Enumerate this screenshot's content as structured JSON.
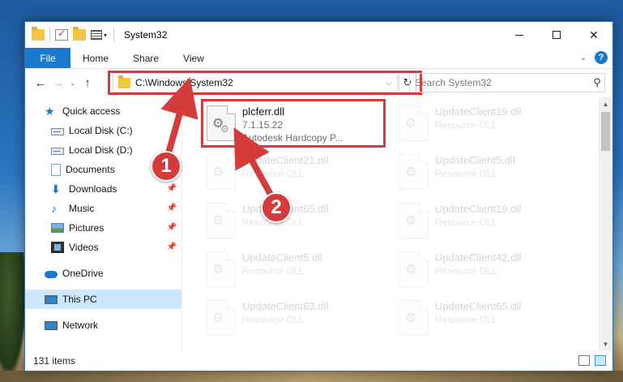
{
  "window": {
    "title": "System32",
    "controls": {
      "minimize": "minimize",
      "maximize": "maximize",
      "close": "✕"
    }
  },
  "ribbon": {
    "tabs": [
      {
        "label": "File",
        "active": true
      },
      {
        "label": "Home"
      },
      {
        "label": "Share"
      },
      {
        "label": "View"
      }
    ],
    "expand": "⌄",
    "help": "?"
  },
  "address": {
    "path": "C:\\Windows\\System32",
    "dropdown": "⌵",
    "refresh": "↻",
    "search_placeholder": "Search System32",
    "search_icon": "⚲"
  },
  "nav_buttons": {
    "back": "←",
    "forward": "→",
    "recent": "⌄",
    "up": "↑"
  },
  "sidebar": {
    "items": [
      {
        "label": "Quick access",
        "icon": "star-icon",
        "pinned": false
      },
      {
        "label": "Local Disk (C:)",
        "icon": "disk-icon",
        "pinned": false
      },
      {
        "label": "Local Disk (D:)",
        "icon": "disk-icon",
        "pinned": false
      },
      {
        "label": "Documents",
        "icon": "documents-icon",
        "pinned": false
      },
      {
        "label": "Downloads",
        "icon": "downloads-icon",
        "pinned": true
      },
      {
        "label": "Music",
        "icon": "music-icon",
        "pinned": true
      },
      {
        "label": "Pictures",
        "icon": "pictures-icon",
        "pinned": true
      },
      {
        "label": "Videos",
        "icon": "videos-icon",
        "pinned": true
      },
      {
        "label": "OneDrive",
        "icon": "onedrive-icon",
        "pinned": false
      },
      {
        "label": "This PC",
        "icon": "this-pc-icon",
        "pinned": false,
        "selected": true
      },
      {
        "label": "Network",
        "icon": "network-icon",
        "pinned": false
      }
    ],
    "pin_glyph": "📌"
  },
  "files": [
    {
      "name": "plcferr.dll",
      "line2": "7.1.15.22",
      "line3": "Autodesk Hardcopy P..."
    },
    {
      "name": "UpdateClient19.dll",
      "line2": "Resource DLL"
    },
    {
      "name": "UpdateClient21.dll",
      "line2": "Resource DLL"
    },
    {
      "name": "UpdateClient5.dll",
      "line2": "Resource DLL"
    },
    {
      "name": "UpdateClient65.dll",
      "line2": "Resource DLL"
    },
    {
      "name": "UpdateClient19.dll",
      "line2": "Resource DLL"
    },
    {
      "name": "UpdateClient5.dll",
      "line2": "Resource DLL"
    },
    {
      "name": "UpdateClient42.dll",
      "line2": "Resource DLL"
    },
    {
      "name": "UpdateClient63.dll",
      "line2": "Resource DLL"
    },
    {
      "name": "UpdateClient65.dll",
      "line2": "Resource DLL"
    }
  ],
  "status": {
    "count": "131 items"
  },
  "annotations": {
    "step1": "1",
    "step2": "2",
    "color": "#d63b3b"
  },
  "scrollbar": {
    "up": "▲",
    "down": "▼"
  },
  "colors": {
    "accent": "#1979ca",
    "selected_bg": "#cce8ff",
    "highlight": "#d63b3b"
  }
}
